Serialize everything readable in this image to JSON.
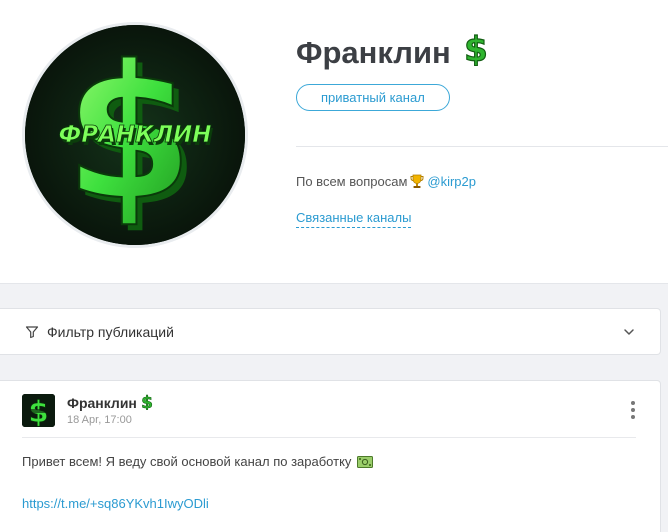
{
  "channel": {
    "title": "Франклин",
    "title_emoji": "💲",
    "badge": "приватный канал",
    "description_prefix": "По всем вопросам",
    "description_icon": "trophy-icon",
    "contact_link": "@kirp2p",
    "related_link": "Связанные каналы",
    "avatar_text": "ФРАНКЛИН"
  },
  "filter": {
    "label": "Фильтр публикаций",
    "icon": "funnel-icon"
  },
  "post": {
    "author": "Франклин",
    "author_emoji": "💲",
    "date": "18 Apr, 17:00",
    "text": "Привет всем! Я веду свой основой канал по заработку",
    "text_icon": "money-icon",
    "link": "https://t.me/+sq86YKvh1IwyODli"
  },
  "colors": {
    "accent": "#2b9bd1",
    "dollar_green": "#3ee03e",
    "avatar_bg": "#0b1a0e"
  }
}
